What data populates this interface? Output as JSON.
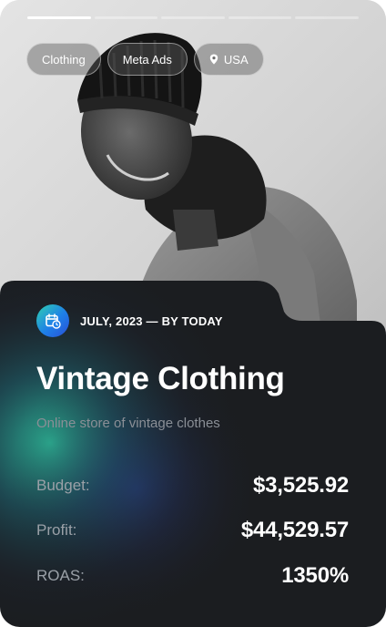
{
  "progress": [
    {
      "fill": 1.0
    },
    {
      "fill": 0
    },
    {
      "fill": 0
    },
    {
      "fill": 0
    },
    {
      "fill": 0
    }
  ],
  "tags": [
    {
      "label": "Clothing",
      "icon": ""
    },
    {
      "label": "Meta Ads",
      "icon": ""
    },
    {
      "label": "USA",
      "icon": "location-pin-icon"
    }
  ],
  "campaign": {
    "icon": "calendar-clock-icon",
    "date": "JULY, 2023 — BY TODAY",
    "title": "Vintage Clothing",
    "subtitle": "Online store of vintage clothes"
  },
  "stats": {
    "budget": {
      "label": "Budget:",
      "value": "$3,525.92"
    },
    "profit": {
      "label": "Profit:",
      "value": "$44,529.57"
    },
    "roas": {
      "label": "ROAS:",
      "value": "1350%"
    }
  },
  "colors": {
    "panel": "#1b1d20",
    "accent_teal": "#2fd1b1",
    "accent_blue": "#1e7fe8",
    "muted_text": "#8a8f96"
  }
}
